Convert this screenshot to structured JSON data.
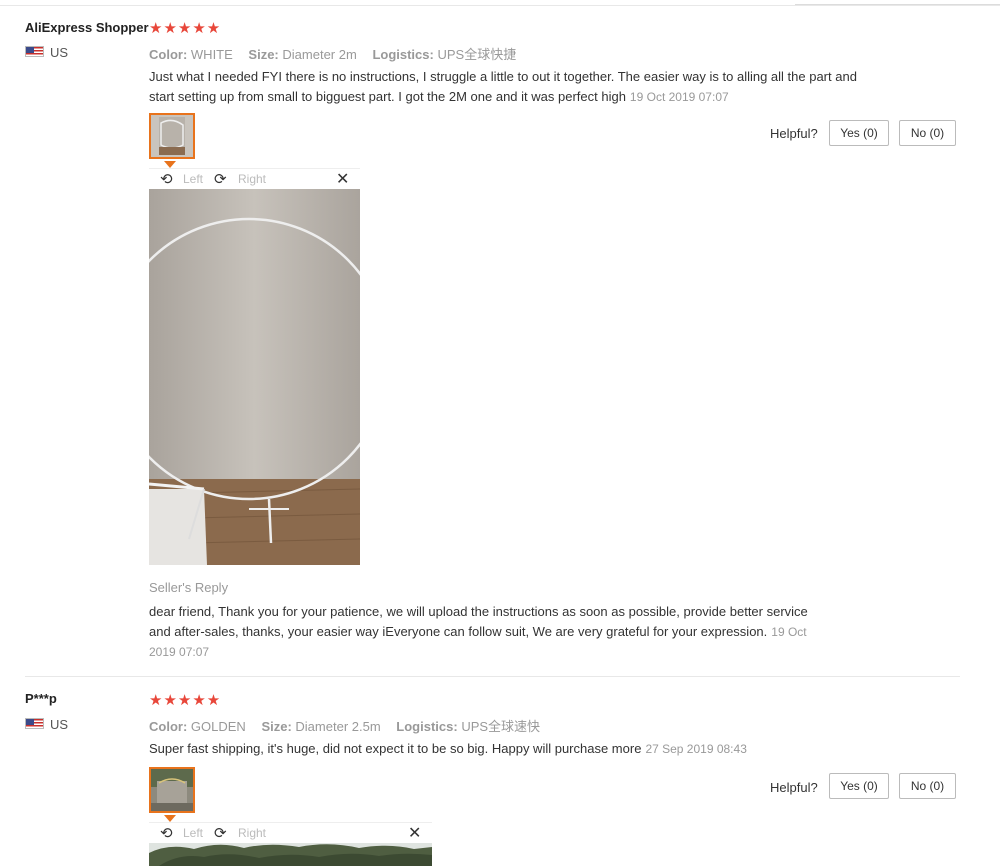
{
  "reviews": [
    {
      "user": "AliExpress Shopper",
      "country": "US",
      "stars": "★★★★★",
      "color_label": "Color:",
      "color_value": "WHITE",
      "size_label": "Size:",
      "size_value": "Diameter 2m",
      "logistics_label": "Logistics:",
      "logistics_value": "UPS全球快捷",
      "text": "Just what I needed FYI there is no instructions, I struggle a little to out it together. The easier way is to alling all the part and start setting up from small to bigguest part. I got the 2M one and it was perfect high",
      "date": "19 Oct 2019 07:07",
      "helpful_label": "Helpful?",
      "yes_label": "Yes (0)",
      "no_label": "No (0)",
      "viewer": {
        "left_label": "Left",
        "right_label": "Right",
        "close_icon": "close-icon"
      },
      "seller_reply_title": "Seller's Reply",
      "seller_reply_text": "dear friend, Thank you for your patience, we will upload the instructions as soon as possible, provide better service and after-sales, thanks, your easier way iEveryone can follow suit, We are very grateful for your expression.",
      "seller_reply_date": "19 Oct 2019 07:07"
    },
    {
      "user": "P***p",
      "country": "US",
      "stars": "★★★★★",
      "color_label": "Color:",
      "color_value": "GOLDEN",
      "size_label": "Size:",
      "size_value": "Diameter 2.5m",
      "logistics_label": "Logistics:",
      "logistics_value": "UPS全球速快",
      "text": "Super fast shipping, it's huge, did not expect it to be so big. Happy will purchase more",
      "date": "27 Sep 2019 08:43",
      "helpful_label": "Helpful?",
      "yes_label": "Yes (0)",
      "no_label": "No (0)",
      "viewer": {
        "left_label": "Left",
        "right_label": "Right",
        "close_icon": "close-icon"
      }
    }
  ],
  "colors": {
    "star": "#e8473a",
    "thumb_border": "#e8731c",
    "muted": "#999999"
  }
}
